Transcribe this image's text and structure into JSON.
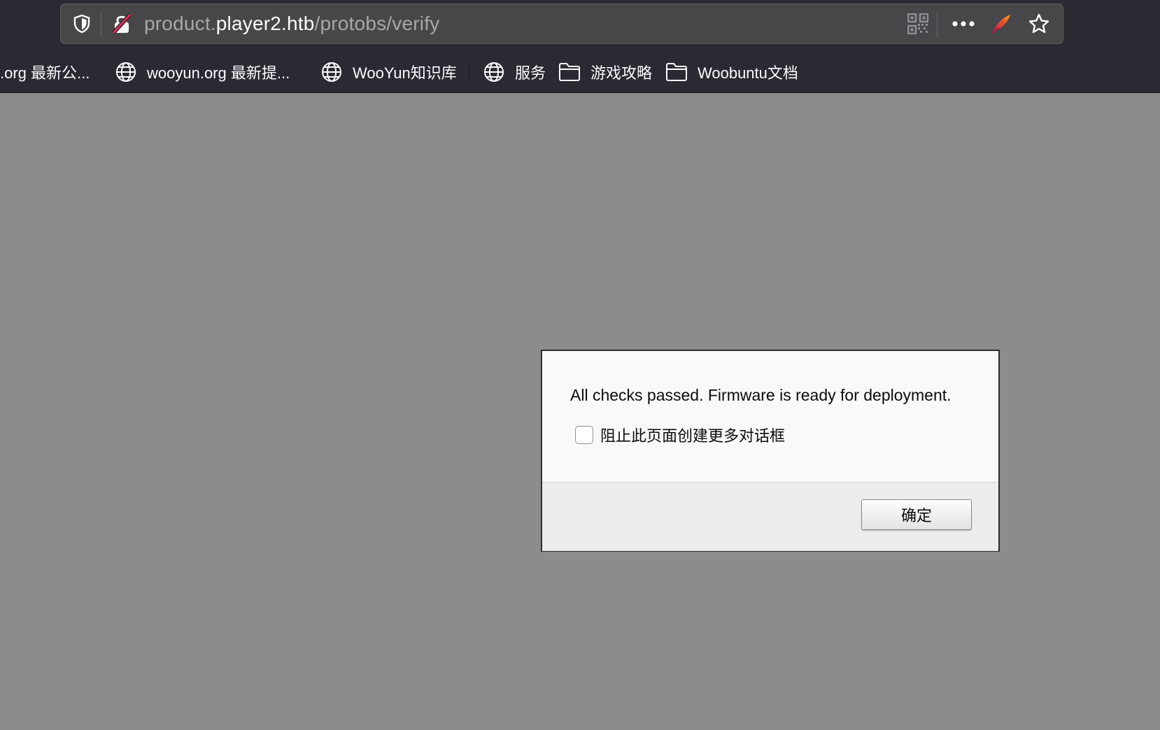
{
  "urlbar": {
    "url_scheme_prefix": "product.",
    "url_host": "player2.htb",
    "url_path": "/protobs/verify",
    "icons": {
      "tracking_protection": "shield-icon",
      "connection": "insecure-lock-icon",
      "qr_code": "qr-code-icon",
      "page_actions": "more-horizontal-icon",
      "extension": "feather-icon",
      "bookmark": "star-icon"
    }
  },
  "bookmarks": [
    {
      "label": ".org 最新公...",
      "icon": "none"
    },
    {
      "label": "wooyun.org 最新提...",
      "icon": "globe-icon"
    },
    {
      "label": "WooYun知识库",
      "icon": "globe-icon"
    },
    {
      "label": "服务",
      "icon": "globe-icon"
    },
    {
      "label": "游戏攻略",
      "icon": "folder-icon"
    },
    {
      "label": "Woobuntu文档",
      "icon": "folder-icon"
    }
  ],
  "dialog": {
    "message": "All checks passed. Firmware is ready for deployment.",
    "suppress_label": "阻止此页面创建更多对话框",
    "suppress_checked": false,
    "ok_label": "确定"
  },
  "colors": {
    "chrome_background": "#2b2a33",
    "urlbar_background": "#474749",
    "page_overlay": "#8c8c8c",
    "dialog_background": "#f9f9f9",
    "dialog_footer": "#ececec",
    "insecure_lock_accent": "#e22850"
  }
}
